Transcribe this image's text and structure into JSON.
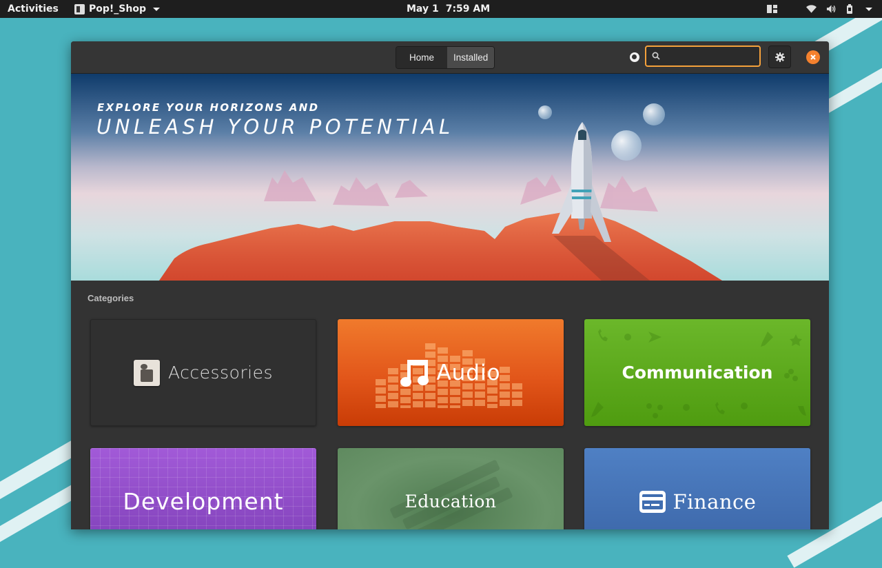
{
  "topbar": {
    "activities": "Activities",
    "app_name": "Pop!_Shop",
    "date": "May 1",
    "time": "7:59 AM"
  },
  "header": {
    "tabs": [
      {
        "label": "Home",
        "active": false
      },
      {
        "label": "Installed",
        "active": true
      }
    ],
    "search_placeholder": ""
  },
  "banner": {
    "line1": "EXPLORE YOUR HORIZONS AND",
    "line2": "UNLEASH YOUR POTENTIAL"
  },
  "categories": {
    "title": "Categories",
    "tiles": [
      {
        "label": "Accessories"
      },
      {
        "label": "Audio"
      },
      {
        "label": "Communication"
      },
      {
        "label": "Development"
      },
      {
        "label": "Education"
      },
      {
        "label": "Finance"
      }
    ]
  },
  "colors": {
    "accent": "#f4812e",
    "search_border": "#f5a13b",
    "audio": "#e2561a",
    "communication": "#5aa61a",
    "development": "#8f4ec6",
    "education": "#5f8a5f",
    "finance": "#3f6db0"
  }
}
